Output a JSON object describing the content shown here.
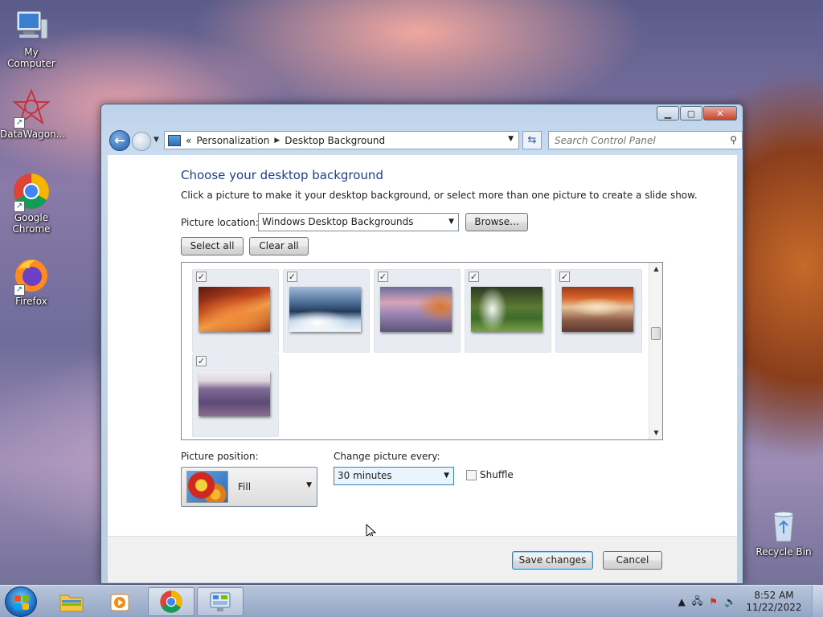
{
  "desktop": {
    "icons": [
      {
        "label": "My Computer",
        "icon": "computer-icon"
      },
      {
        "label": "DataWagon...",
        "icon": "datawagon-icon"
      },
      {
        "label": "Google Chrome",
        "icon": "chrome-icon"
      },
      {
        "label": "Firefox",
        "icon": "firefox-icon"
      },
      {
        "label": "Recycle Bin",
        "icon": "recycle-bin-icon"
      }
    ]
  },
  "window": {
    "breadcrumb": [
      "Personalization",
      "Desktop Background"
    ],
    "search_placeholder": "Search Control Panel",
    "heading": "Choose your desktop background",
    "subtext": "Click a picture to make it your desktop background, or select more than one picture to create a slide show.",
    "picture_location_label": "Picture location:",
    "picture_location_value": "Windows Desktop Backgrounds",
    "browse_label": "Browse...",
    "select_all_label": "Select all",
    "clear_all_label": "Clear all",
    "pictures": [
      {
        "name": "red-canyon",
        "checked": true
      },
      {
        "name": "glacier-lake",
        "checked": true
      },
      {
        "name": "rocky-coast",
        "checked": true
      },
      {
        "name": "waterfall",
        "checked": true
      },
      {
        "name": "rock-arch",
        "checked": true
      },
      {
        "name": "lavender-field",
        "checked": true
      }
    ],
    "picture_position_label": "Picture position:",
    "picture_position_value": "Fill",
    "change_every_label": "Change picture every:",
    "change_every_value": "30 minutes",
    "shuffle_label": "Shuffle",
    "shuffle_checked": false,
    "save_label": "Save changes",
    "cancel_label": "Cancel"
  },
  "taskbar": {
    "time": "8:52 AM",
    "date": "11/22/2022"
  },
  "colors": {
    "heading": "#1e3f8f",
    "accent": "#1f5aa8"
  }
}
